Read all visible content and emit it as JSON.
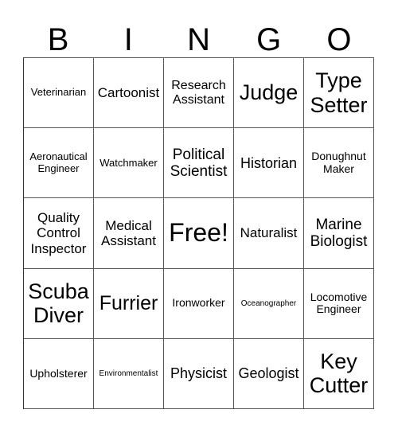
{
  "header": [
    "B",
    "I",
    "N",
    "G",
    "O"
  ],
  "cells": [
    {
      "text": "Veterinarian",
      "size": 13
    },
    {
      "text": "Cartoonist",
      "size": 17
    },
    {
      "text": "Research Assistant",
      "size": 16
    },
    {
      "text": "Judge",
      "size": 27
    },
    {
      "text": "Type Setter",
      "size": 27
    },
    {
      "text": "Aeronautical Engineer",
      "size": 13
    },
    {
      "text": "Watchmaker",
      "size": 13
    },
    {
      "text": "Political Scientist",
      "size": 19
    },
    {
      "text": "Historian",
      "size": 18
    },
    {
      "text": "Donughnut Maker",
      "size": 14
    },
    {
      "text": "Quality Control Inspector",
      "size": 17
    },
    {
      "text": "Medical Assistant",
      "size": 17
    },
    {
      "text": "Free!",
      "size": 32
    },
    {
      "text": "Naturalist",
      "size": 17
    },
    {
      "text": "Marine Biologist",
      "size": 19
    },
    {
      "text": "Scuba Diver",
      "size": 27
    },
    {
      "text": "Furrier",
      "size": 25
    },
    {
      "text": "Ironworker",
      "size": 14
    },
    {
      "text": "Oceanographer",
      "size": 10
    },
    {
      "text": "Locomotive Engineer",
      "size": 14
    },
    {
      "text": "Upholsterer",
      "size": 14
    },
    {
      "text": "Environmentalist",
      "size": 10
    },
    {
      "text": "Physicist",
      "size": 18
    },
    {
      "text": "Geologist",
      "size": 18
    },
    {
      "text": "Key Cutter",
      "size": 27
    }
  ]
}
